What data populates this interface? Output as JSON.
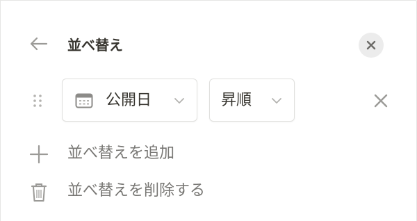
{
  "header": {
    "title": "並べ替え"
  },
  "sort_rule": {
    "field_label": "公開日",
    "order_label": "昇順"
  },
  "actions": {
    "add_label": "並べ替えを追加",
    "delete_label": "並べ替えを削除する"
  },
  "icons": {
    "back": "arrow-left-icon",
    "close": "close-icon",
    "drag": "drag-handle-icon",
    "field_type": "calendar-icon",
    "dropdown": "chevron-down-icon",
    "add": "plus-icon",
    "delete": "trash-icon"
  },
  "colors": {
    "text": "#37352f",
    "muted_text": "#787774",
    "icon_gray": "#a5a4a1",
    "border": "#dfdfdd",
    "close_bg": "#ececec"
  }
}
